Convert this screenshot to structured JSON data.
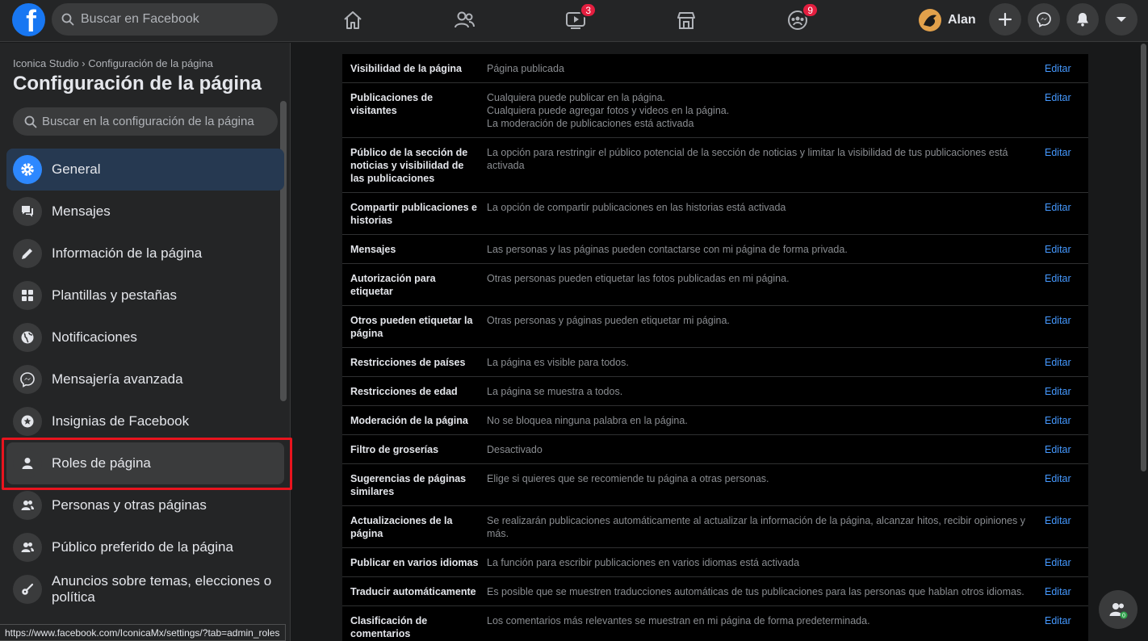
{
  "topbar": {
    "search_placeholder": "Buscar en Facebook",
    "watch_badge": "3",
    "groups_badge": "9",
    "user_name": "Alan"
  },
  "sidebar": {
    "breadcrumb": "Iconica Studio › Configuración de la página",
    "title": "Configuración de la página",
    "search_placeholder": "Buscar en la configuración de la página",
    "items": [
      {
        "label": "General",
        "icon": "gear-icon"
      },
      {
        "label": "Mensajes",
        "icon": "chat-icon"
      },
      {
        "label": "Información de la página",
        "icon": "pencil-icon"
      },
      {
        "label": "Plantillas y pestañas",
        "icon": "grid-icon"
      },
      {
        "label": "Notificaciones",
        "icon": "globe-icon"
      },
      {
        "label": "Mensajería avanzada",
        "icon": "messenger-icon"
      },
      {
        "label": "Insignias de Facebook",
        "icon": "star-badge-icon"
      },
      {
        "label": "Roles de página",
        "icon": "person-icon"
      },
      {
        "label": "Personas y otras páginas",
        "icon": "people-icon"
      },
      {
        "label": "Público preferido de la página",
        "icon": "people-icon"
      },
      {
        "label": "Anuncios sobre temas, elecciones o política",
        "icon": "guitar-icon"
      }
    ]
  },
  "status_url": "https://www.facebook.com/IconicaMx/settings/?tab=admin_roles",
  "settings": {
    "edit_label": "Editar",
    "rows": [
      {
        "label": "Visibilidad de la página",
        "value": "Página publicada"
      },
      {
        "label": "Publicaciones de visitantes",
        "value": "Cualquiera puede publicar en la página.\nCualquiera puede agregar fotos y videos en la página.\nLa moderación de publicaciones está activada"
      },
      {
        "label": "Público de la sección de noticias y visibilidad de las publicaciones",
        "value": "La opción para restringir el público potencial de la sección de noticias y limitar la visibilidad de tus publicaciones está activada"
      },
      {
        "label": "Compartir publicaciones e historias",
        "value": "La opción de compartir publicaciones en las historias está activada"
      },
      {
        "label": "Mensajes",
        "value": "Las personas y las páginas pueden contactarse con mi página de forma privada."
      },
      {
        "label": "Autorización para etiquetar",
        "value": "Otras personas pueden etiquetar las fotos publicadas en mi página."
      },
      {
        "label": "Otros pueden etiquetar la página",
        "value": "Otras personas y páginas pueden etiquetar mi página."
      },
      {
        "label": "Restricciones de países",
        "value": "La página es visible para todos."
      },
      {
        "label": "Restricciones de edad",
        "value": "La página se muestra a todos."
      },
      {
        "label": "Moderación de la página",
        "value": "No se bloquea ninguna palabra en la página."
      },
      {
        "label": "Filtro de groserías",
        "value": "Desactivado"
      },
      {
        "label": "Sugerencias de páginas similares",
        "value": "Elige si quieres que se recomiende tu página a otras personas."
      },
      {
        "label": "Actualizaciones de la página",
        "value": "Se realizarán publicaciones automáticamente al actualizar la información de la página, alcanzar hitos, recibir opiniones y más."
      },
      {
        "label": "Publicar en varios idiomas",
        "value": "La función para escribir publicaciones en varios idiomas está activada"
      },
      {
        "label": "Traducir automáticamente",
        "value": "Es posible que se muestren traducciones automáticas de tus publicaciones para las personas que hablan otros idiomas."
      },
      {
        "label": "Clasificación de comentarios",
        "value": "Los comentarios más relevantes se muestran en mi página de forma predeterminada."
      }
    ]
  },
  "contacts_badge": "0",
  "colors": {
    "accent": "#2d88ff",
    "link": "#4599ff",
    "highlight_box": "#e8141e",
    "badge": "#e41e3f"
  }
}
